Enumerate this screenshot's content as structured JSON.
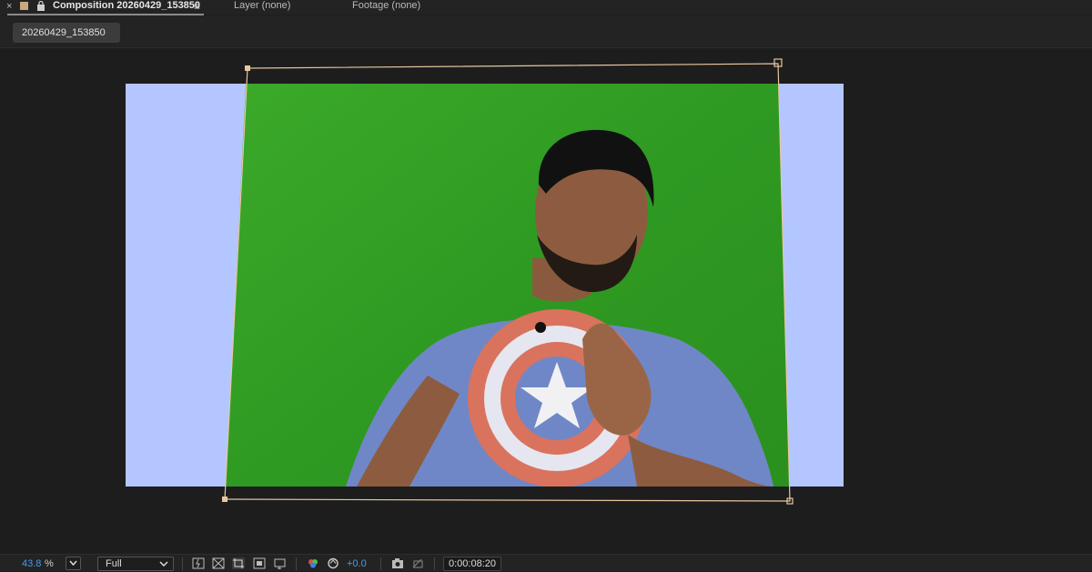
{
  "tabs": {
    "composition_label": "Composition 20260429_153850",
    "layer_label": "Layer (none)",
    "footage_label": "Footage (none)"
  },
  "breadcrumb": {
    "comp_name": "20260429_153850"
  },
  "viewer": {
    "comp_background_color": "#b4c6ff",
    "footage_description_color": "#3aa62c",
    "bounding_box_color": "#e8c6a0"
  },
  "toolbar": {
    "zoom_value": "43.8",
    "zoom_unit": "%",
    "resolution": "Full",
    "exposure": "+0.0",
    "timecode": "0:00:08:20"
  },
  "colors": {
    "accent_blue": "#4a9af0",
    "panel_bg": "#1d1d1d"
  }
}
